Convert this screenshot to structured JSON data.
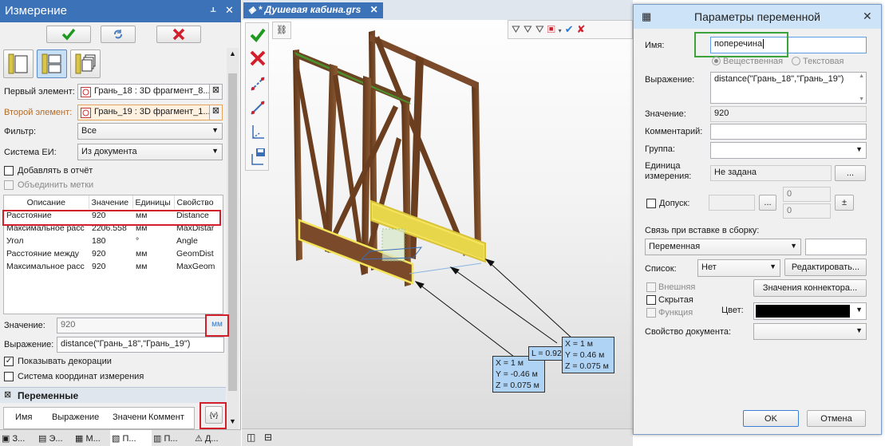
{
  "left_panel": {
    "title": "Измерение",
    "pin_glyph": "ᚆ",
    "close_glyph": "✕",
    "first_label": "Первый элемент:",
    "first_value": "Грань_18 : 3D фрагмент_8...",
    "second_label": "Второй элемент:",
    "second_value": "Грань_19 : 3D фрагмент_1...",
    "filter_label": "Фильтр:",
    "filter_value": "Все",
    "system_label": "Система ЕИ:",
    "system_value": "Из документа",
    "add_report_label": "Добавлять в отчёт",
    "merge_marks_label": "Объединить метки",
    "table": {
      "headers": [
        "Описание",
        "Значение",
        "Единицы",
        "Свойство"
      ],
      "rows": [
        [
          "Расстояние",
          "920",
          "мм",
          "Distance"
        ],
        [
          "Максимальное расс",
          "2206.558",
          "мм",
          "MaxDistar"
        ],
        [
          "Угол",
          "180",
          "°",
          "Angle"
        ],
        [
          "Расстояние между",
          "920",
          "мм",
          "GeomDist"
        ],
        [
          "Максимальное расс",
          "920",
          "мм",
          "MaxGeom"
        ]
      ]
    },
    "value_label": "Значение:",
    "value_value": "920",
    "value_unit": "мм",
    "expr_label": "Выражение:",
    "expr_value": "distance(\"Грань_18\",\"Грань_19\")",
    "show_decor_label": "Показывать декорации",
    "coord_sys_label": "Система координат измерения",
    "variables_header": "Переменные",
    "var_table_headers": [
      "Имя",
      "Выражение",
      "Значени",
      "Коммент"
    ],
    "var_btn_label": "{v}",
    "bottom_tabs": [
      "З...",
      "Э...",
      "М...",
      "П...",
      "П...",
      "Д..."
    ]
  },
  "viewport": {
    "tab_title": "* Душевая кабина.grs",
    "tab_close": "✕",
    "tooltips": [
      "X = 1 м\nY = -0.46 м\nZ = 0.075 м",
      "L = 0.92 м",
      "X = 1 м\nY = 0.46 м\nZ = 0.075 м"
    ]
  },
  "dialog": {
    "title": "Параметры переменной",
    "name_label": "Имя:",
    "name_value": "поперечина",
    "type_real": "Вещественная",
    "type_text": "Текстовая",
    "expr_label": "Выражение:",
    "expr_value": "distance(\"Грань_18\",\"Грань_19\")",
    "value_label": "Значение:",
    "value_value": "920",
    "comment_label": "Комментарий:",
    "comment_value": "",
    "group_label": "Группа:",
    "group_value": "",
    "unit_label": "Единица измерения:",
    "unit_value": "Не задана",
    "ellipsis": "...",
    "tolerance_label": "Допуск:",
    "tol_upper": "0",
    "tol_lower": "0",
    "pm": "±",
    "link_label": "Связь при вставке в сборку:",
    "link_value": "Переменная",
    "list_label": "Список:",
    "list_value": "Нет",
    "edit_button": "Редактировать...",
    "external_label": "Внешняя",
    "hidden_label": "Скрытая",
    "function_label": "Функция",
    "connector_button": "Значения коннектора...",
    "color_label": "Цвет:",
    "color_value": "#000000",
    "doc_prop_label": "Свойство документа:",
    "ok_button": "OK",
    "cancel_button": "Отмена"
  },
  "colors": {
    "title_blue": "#3c72b8",
    "highlight_red": "#d21f2b",
    "highlight_green": "#3aa43a",
    "beam_brown": "#7a4a2a",
    "selection_yellow": "#f3e45a"
  }
}
